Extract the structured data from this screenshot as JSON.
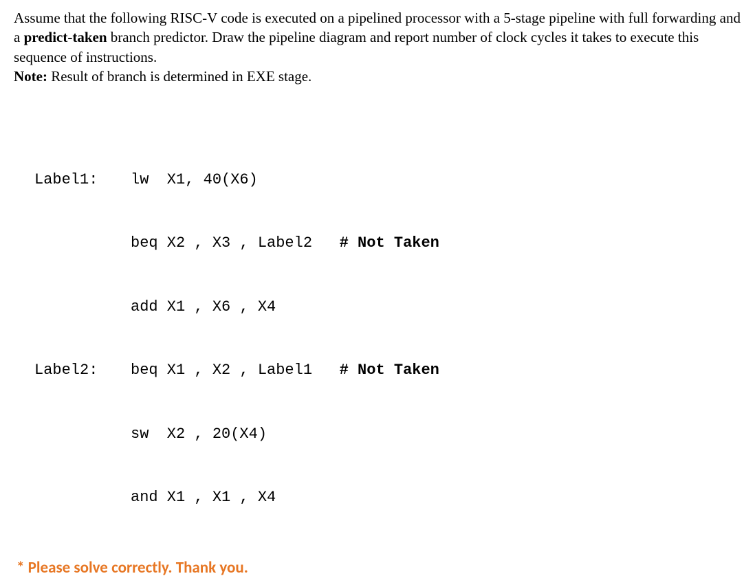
{
  "intro": {
    "line1_pre": "Assume that the following RISC-V code is executed on a pipelined processor with a 5-stage pipeline with full forwarding and a ",
    "line1_bold": "predict-taken",
    "line1_post": " branch predictor. Draw the pipeline diagram and report number of clock cycles it takes to execute this sequence of instructions.",
    "note_label": "Note:",
    "note_text": " Result of branch is determined in EXE stage."
  },
  "code": [
    {
      "label": "Label1:",
      "instr": "lw  X1, 40(X6)",
      "comment": ""
    },
    {
      "label": "",
      "instr": "beq X2 , X3 , Label2   ",
      "comment": "# Not Taken"
    },
    {
      "label": "",
      "instr": "add X1 , X6 , X4",
      "comment": ""
    },
    {
      "label": "Label2:",
      "instr": "beq X1 , X2 , Label1   ",
      "comment": "# Not Taken"
    },
    {
      "label": "",
      "instr": "sw  X2 , 20(X4)",
      "comment": ""
    },
    {
      "label": "",
      "instr": "and X1 , X1 , X4",
      "comment": ""
    }
  ],
  "footer": "* Please solve correctly. Thank you."
}
